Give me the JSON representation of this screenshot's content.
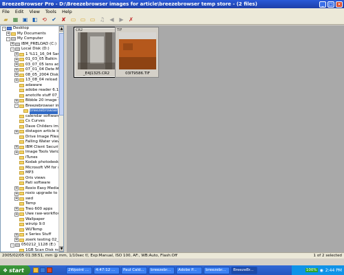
{
  "window": {
    "title": "BreezeBrowser Pro - D:\\Breezebrowser images for article\\breezebrowser temp store - (2 files)"
  },
  "menu": [
    "File",
    "Edit",
    "View",
    "Tools",
    "Help"
  ],
  "tree": {
    "rows": [
      {
        "indent": 0,
        "exp": "-",
        "icon": "desk",
        "label": "Desktop"
      },
      {
        "indent": 1,
        "exp": "+",
        "icon": "folder",
        "label": "My Documents"
      },
      {
        "indent": 1,
        "exp": "-",
        "icon": "drive",
        "label": "My Computer"
      },
      {
        "indent": 2,
        "exp": "+",
        "icon": "drive",
        "label": "IBM_PRELOAD (C:)"
      },
      {
        "indent": 2,
        "exp": "-",
        "icon": "drive",
        "label": "Local Disk (D:)"
      },
      {
        "indent": 3,
        "exp": "+",
        "icon": "folder",
        "label": "1 %11_16_04 Sam"
      },
      {
        "indent": 3,
        "exp": "+",
        "icon": "folder",
        "label": "01_03_05 Balkin bi"
      },
      {
        "indent": 3,
        "exp": "+",
        "icon": "folder",
        "label": "03_07_05 lens adp"
      },
      {
        "indent": 3,
        "exp": "+",
        "icon": "folder",
        "label": "07_01_04 Dete Mor"
      },
      {
        "indent": 3,
        "exp": "+",
        "icon": "folder",
        "label": "08_05_2004 Disk U"
      },
      {
        "indent": 3,
        "exp": "+",
        "icon": "folder",
        "label": "13_08_04 reload m"
      },
      {
        "indent": 3,
        "exp": "",
        "icon": "folder",
        "label": "adaware"
      },
      {
        "indent": 3,
        "exp": "",
        "icon": "folder",
        "label": "adobe reader 6.1"
      },
      {
        "indent": 3,
        "exp": "",
        "icon": "folder",
        "label": "anotcife stuff 07_22"
      },
      {
        "indent": 3,
        "exp": "+",
        "icon": "folder",
        "label": "Bibble 20 image te"
      },
      {
        "indent": 3,
        "exp": "-",
        "icon": "folder",
        "label": "Breezebrowser ima"
      },
      {
        "indent": 4,
        "exp": "",
        "icon": "folder",
        "label": "breezebrowser",
        "selected": true
      },
      {
        "indent": 3,
        "exp": "",
        "icon": "folder",
        "label": "calendar software"
      },
      {
        "indent": 3,
        "exp": "",
        "icon": "folder",
        "label": "Cs Curves"
      },
      {
        "indent": 3,
        "exp": "",
        "icon": "folder",
        "label": "Dave Childers imag"
      },
      {
        "indent": 3,
        "exp": "+",
        "icon": "folder",
        "label": "distagon article ime"
      },
      {
        "indent": 3,
        "exp": "",
        "icon": "folder",
        "label": "Drive Image Files"
      },
      {
        "indent": 3,
        "exp": "",
        "icon": "folder",
        "label": "Falling Water view"
      },
      {
        "indent": 3,
        "exp": "+",
        "icon": "folder",
        "label": "IBM Client Security"
      },
      {
        "indent": 3,
        "exp": "+",
        "icon": "folder",
        "label": "Image Tools Vario"
      },
      {
        "indent": 3,
        "exp": "",
        "icon": "folder",
        "label": "iTunes"
      },
      {
        "indent": 3,
        "exp": "",
        "icon": "folder",
        "label": "Kodak photodesk i"
      },
      {
        "indent": 3,
        "exp": "",
        "icon": "folder",
        "label": "Microsoft VM for ne"
      },
      {
        "indent": 3,
        "exp": "",
        "icon": "folder",
        "label": "MP3"
      },
      {
        "indent": 3,
        "exp": "",
        "icon": "folder",
        "label": "Oris views"
      },
      {
        "indent": 3,
        "exp": "",
        "icon": "folder",
        "label": "Pati software"
      },
      {
        "indent": 3,
        "exp": "+",
        "icon": "folder",
        "label": "Roxio Easy Media"
      },
      {
        "indent": 3,
        "exp": "+",
        "icon": "folder",
        "label": "roxio upgrade to vr"
      },
      {
        "indent": 3,
        "exp": "+",
        "icon": "folder",
        "label": "swd"
      },
      {
        "indent": 3,
        "exp": "",
        "icon": "folder",
        "label": "Temp"
      },
      {
        "indent": 3,
        "exp": "+",
        "icon": "folder",
        "label": "Treo 600 apps"
      },
      {
        "indent": 3,
        "exp": "+",
        "icon": "folder",
        "label": "Uwe raw-workflow p"
      },
      {
        "indent": 3,
        "exp": "",
        "icon": "folder",
        "label": "Wallpaper"
      },
      {
        "indent": 3,
        "exp": "",
        "icon": "folder",
        "label": "winzip 9.0"
      },
      {
        "indent": 3,
        "exp": "",
        "icon": "folder",
        "label": "WUTemp"
      },
      {
        "indent": 3,
        "exp": "+",
        "icon": "folder",
        "label": "x Series Stuff"
      },
      {
        "indent": 3,
        "exp": "+",
        "icon": "folder",
        "label": "zoerk testing 02_10"
      },
      {
        "indent": 2,
        "exp": "-",
        "icon": "drive",
        "label": "050212_1128 (E:)"
      },
      {
        "indent": 3,
        "exp": "",
        "icon": "folder",
        "label": "1GB Scan Disk no1"
      },
      {
        "indent": 3,
        "exp": "",
        "icon": "folder",
        "label": "1GB Scan Disk no2"
      },
      {
        "indent": 3,
        "exp": "",
        "icon": "folder",
        "label": "2GB Scan disk"
      },
      {
        "indent": 1,
        "exp": "+",
        "icon": "folder",
        "label": "Shared Documents"
      }
    ]
  },
  "thumbnails": [
    {
      "type": "CR2",
      "name": "_E4J1325.CR2",
      "active": true,
      "colors": [
        "#8e8b86",
        "#c2c0bb",
        "#4a4238"
      ]
    },
    {
      "type": "TIF",
      "name": "03IT9586.TIF",
      "active": false,
      "colors": [
        "#d7d5d2",
        "#b5581c",
        "#7e3a10"
      ]
    }
  ],
  "status": {
    "left": "2005/02/05 01:38:51, mm @ mm, 1/10sec f/, Exp:Manual, ISO 100, AF:, WB:Auto, Flash:Off",
    "right": "1 of 2 selected"
  },
  "taskbar": {
    "start_label": "start",
    "tasks": [
      {
        "label": "2Wpoint ...",
        "active": false
      },
      {
        "label": "4:47:12 ...",
        "active": false
      },
      {
        "label": "Paul Cald...",
        "active": false
      },
      {
        "label": "breezebr...",
        "active": false
      },
      {
        "label": "Adobe P...",
        "active": false
      },
      {
        "label": "breezebr...",
        "active": false
      },
      {
        "label": "BreezeBr...",
        "active": true
      }
    ],
    "battery": "100%",
    "clock": "2:44 PM"
  }
}
